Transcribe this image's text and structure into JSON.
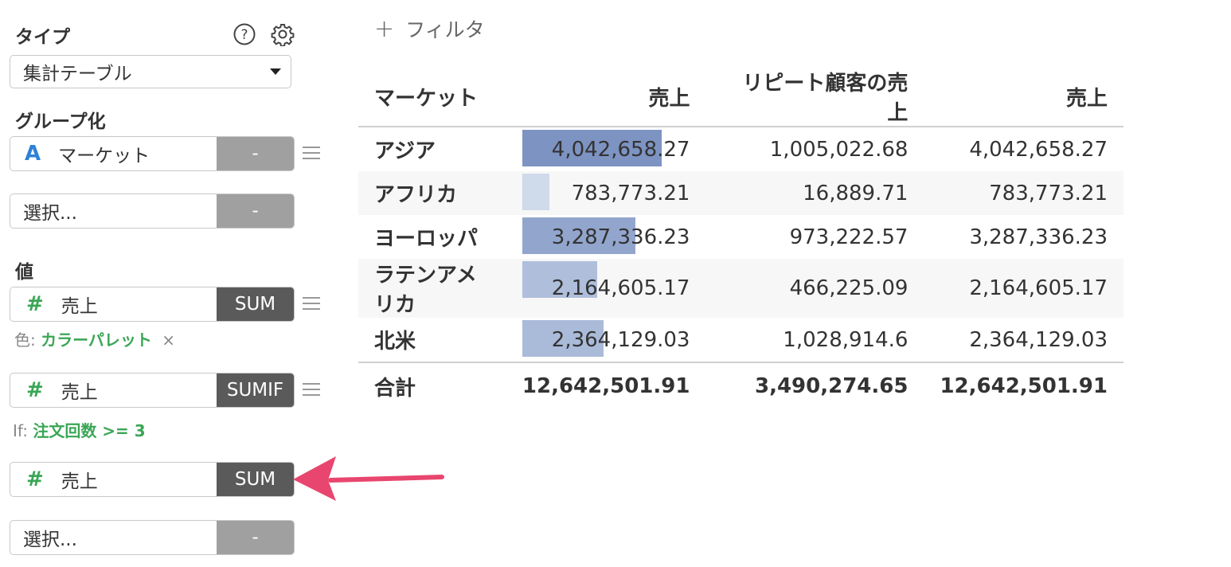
{
  "sidebar": {
    "type_label": "タイプ",
    "type_select": "集計テーブル",
    "group_label": "グループ化",
    "group_field": {
      "name": "マーケット",
      "agg": "-"
    },
    "group_placeholder": {
      "name": "選択...",
      "agg": "-"
    },
    "value_label": "値",
    "value1": {
      "name": "売上",
      "agg": "SUM"
    },
    "color_note": {
      "prefix": "色:",
      "value": "カラーパレット",
      "remove": "×"
    },
    "value2": {
      "name": "売上",
      "agg": "SUMIF"
    },
    "if_note": {
      "prefix": "If:",
      "value": "注文回数 >= 3"
    },
    "value3": {
      "name": "売上",
      "agg": "SUM"
    },
    "value_placeholder": {
      "name": "選択...",
      "agg": "-"
    }
  },
  "filter": {
    "icon": "+",
    "label": "フィルタ"
  },
  "table": {
    "headers": [
      "マーケット",
      "売上",
      "リピート顧客の売上",
      "売上"
    ],
    "rows": [
      {
        "market": "アジア",
        "sales": "4,042,658.27",
        "repeat": "1,005,022.68",
        "sales2": "4,042,658.27",
        "bar_value": 4042658.27
      },
      {
        "market": "アフリカ",
        "sales": "783,773.21",
        "repeat": "16,889.71",
        "sales2": "783,773.21",
        "bar_value": 783773.21
      },
      {
        "market": "ヨーロッパ",
        "sales": "3,287,336.23",
        "repeat": "973,222.57",
        "sales2": "3,287,336.23",
        "bar_value": 3287336.23
      },
      {
        "market": "ラテンアメリカ",
        "sales": "2,164,605.17",
        "repeat": "466,225.09",
        "sales2": "2,164,605.17",
        "bar_value": 2164605.17
      },
      {
        "market": "北米",
        "sales": "2,364,129.03",
        "repeat": "1,028,914.6",
        "sales2": "2,364,129.03",
        "bar_value": 2364129.03
      }
    ],
    "total": {
      "label": "合計",
      "sales": "12,642,501.91",
      "repeat": "3,490,274.65",
      "sales2": "12,642,501.91"
    },
    "bar_colors": {
      "low": "#dce5f2",
      "high": "#7d93c2"
    }
  },
  "colors": {
    "accent_green": "#3aa655",
    "field_blue": "#2f80d8",
    "arrow": "#e8466e"
  }
}
